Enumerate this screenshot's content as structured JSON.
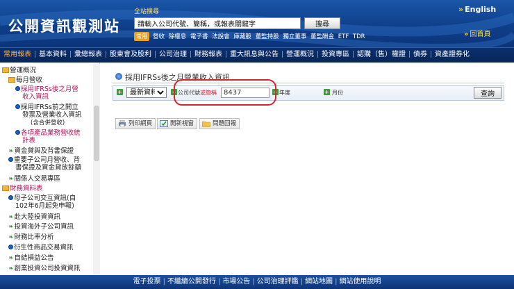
{
  "header": {
    "logo_text": "公開資訊觀測站",
    "search_label": "全站搜尋",
    "search_value": "請輸入公司代號、簡稱，或報表關鍵字",
    "search_button": "搜尋",
    "common_tag": "常用",
    "quick_links": [
      "營收",
      "除權息",
      "電子書",
      "法說會",
      "庫藏股",
      "董監持股",
      "獨立董事",
      "董監酬金",
      "ETF",
      "TDR"
    ],
    "english_label": "English",
    "home_label": "回首頁"
  },
  "main_nav": [
    "常用報表",
    "基本資料",
    "彙總報表",
    "股東會及股利",
    "公司治理",
    "財務報表",
    "重大訊息與公告",
    "營運概況",
    "投資專區",
    "認購（售）權證",
    "債券",
    "資產證券化"
  ],
  "sidebar": {
    "items": [
      {
        "label": "營運概況",
        "icon": "folder-icon"
      },
      {
        "label": "每月營收",
        "icon": "folder-icon"
      },
      {
        "label": "採用IFRSs後之月營",
        "label2": "收入資訊",
        "icon": "dot-icon"
      },
      {
        "label": "採用IFRSs前之開立",
        "label2": "發票及營業收入資訊",
        "label3": "(含合併營收)",
        "icon": "dot-icon"
      },
      {
        "label": "各項產品業務營收統",
        "label2": "計表",
        "icon": "dot-icon"
      },
      {
        "label": "資金貸與及背書保證",
        "icon": "leaf-icon"
      },
      {
        "label": "重要子公司月營收、背",
        "label2": "書保證及資金貸放餘額",
        "icon": "dot-icon"
      },
      {
        "label": "關係人交易專區",
        "icon": "leaf-icon"
      },
      {
        "label": "財務資料表",
        "icon": "folder-icon"
      },
      {
        "label": "母子公司交互資訊(自",
        "label2": "102年6月起免申報)",
        "icon": "dot-icon"
      },
      {
        "label": "赴大陸投資資訊",
        "icon": "leaf-icon"
      },
      {
        "label": "投資海外子公司資訊",
        "icon": "leaf-icon"
      },
      {
        "label": "財務比率分析",
        "icon": "leaf-icon"
      },
      {
        "label": "衍生性商品交易資訊",
        "icon": "dot-icon"
      },
      {
        "label": "自結損益公告",
        "icon": "leaf-icon"
      },
      {
        "label": "創業投資公司投資資訊",
        "icon": "leaf-icon"
      }
    ]
  },
  "content": {
    "title": "採用IFRSs後之月營業收入資訊",
    "select_value": "最新資料",
    "code_label_prefix": "公司代號",
    "code_label_suffix": "或簡稱",
    "code_value": "8437",
    "year_label": "年度",
    "month_label": "月份",
    "query_button": "查詢",
    "tools": [
      "列印網頁",
      "開新視窗",
      "問題回報"
    ]
  },
  "footer": [
    "電子投票",
    "不繼續公開發行",
    "市場公告",
    "公司治理評鑑",
    "網站地圖",
    "網站使用說明"
  ],
  "colors": {
    "header_blue": "#0f3f8a",
    "nav_active": "#ffb54a",
    "sidebar_highlight": "#b4135f",
    "highlight_ring": "#d8252a"
  }
}
